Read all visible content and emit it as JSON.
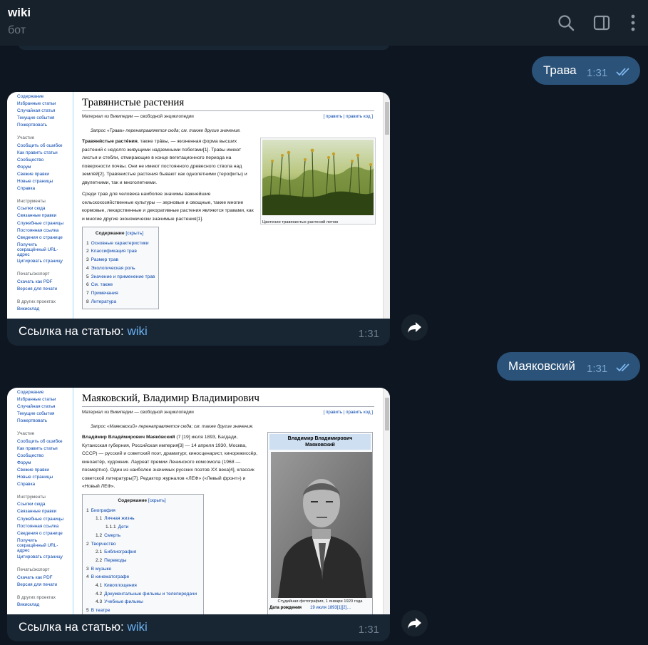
{
  "header": {
    "title": "wiki",
    "subtitle": "бот"
  },
  "messages_out": [
    {
      "text": "Трава",
      "time": "1:31"
    },
    {
      "text": "Маяковский",
      "time": "1:31"
    }
  ],
  "sidebar": {
    "nav": [
      "Содержание",
      "Избранные статьи",
      "Случайная статья",
      "Текущие события",
      "Пожертвовать"
    ],
    "group_participation": "Участие",
    "participation": [
      "Сообщить об ошибке",
      "Как править статьи",
      "Сообщество",
      "Форум",
      "Свежие правки",
      "Новые страницы",
      "Справка"
    ],
    "group_tools": "Инструменты",
    "tools": [
      "Ссылки сюда",
      "Связанные правки",
      "Служебные страницы",
      "Постоянная ссылка",
      "Сведения о странице",
      "Получить сокращённый URL-адрес",
      "Цитировать страницу"
    ],
    "group_print": "Печать/экспорт",
    "print": [
      "Скачать как PDF",
      "Версия для печати"
    ],
    "group_other": "В других проектах",
    "other": [
      "Викисклад"
    ]
  },
  "wiki1": {
    "title": "Травянистые растения",
    "source": "Материал из Википедии — свободной энциклопедии",
    "edit": "[ править | править код ]",
    "redirect": "Запрос «Трава» перенаправляется сюда; см. также другие значения.",
    "p1_bold": "Травяни́стые расте́ния",
    "p1_rest": ", также тра́вы, — жизненная форма высших растений с недолго живущими надземными побегами[1]. Травы имеют листья и стебли, отмирающие в конце вегетационного периода на поверхности почвы. Они не имеют постоянного древесного ствола над землёй[2]. Травянистые растения бывают как однолетними (терофиты) и двулетними, так и многолетними.",
    "p2": "Среди трав для человека наиболее значимы важнейшие сельскохозяйственные культуры — зерновые и овощные, также многие кормовые, лекарственные и декоративные растения являются травами, как и многие другие экономически значимые растения[1].",
    "image_caption": "Цветение травянистых растений летом",
    "toc_title": "Содержание",
    "toc_hide": "[скрыть]",
    "toc": [
      {
        "n": "1",
        "t": "Основные характеристики"
      },
      {
        "n": "2",
        "t": "Классификация трав"
      },
      {
        "n": "3",
        "t": "Размер трав"
      },
      {
        "n": "4",
        "t": "Экологическая роль"
      },
      {
        "n": "5",
        "t": "Значение и применение трав"
      },
      {
        "n": "6",
        "t": "См. также"
      },
      {
        "n": "7",
        "t": "Примечания"
      },
      {
        "n": "8",
        "t": "Литература"
      }
    ]
  },
  "wiki2": {
    "title": "Маяковский, Владимир Владимирович",
    "source": "Материал из Википедии — свободной энциклопедии",
    "edit": "[ править | править код ]",
    "redirect": "Запрос «Маяковский» перенаправляется сюда; см. также другие значения.",
    "p1_bold": "Влади́мир Влади́мирович Маяко́вский",
    "p1_rest": " (7 [19] июля 1893, Багдади, Кутаисская губерния, Российская империя[3] — 14 апреля 1930, Москва, СССР) — русский и советский поэт, драматург, киносценарист, кинорежиссёр, киноактёр, художник. Лауреат премии Ленинского комсомола (1968 — посмертно). Один из наиболее значимых русских поэтов XX века[4], классик советской литературы[7]. Редактор журналов «ЛЕФ» («Левый фронт») и «Новый ЛЕФ».",
    "infobox_name": "Владимир Владимирович Маяковский",
    "infobox_caption": "Студийная фотография, 1 январи 1920 года",
    "infobox_birth_label": "Дата рождения",
    "infobox_birth_value": "19 июля 1893[1][2]…",
    "toc_title": "Содержание",
    "toc_hide": "[скрыть]",
    "toc": [
      {
        "n": "1",
        "t": "Биография",
        "lvl": 0
      },
      {
        "n": "1.1",
        "t": "Личная жизнь",
        "lvl": 1
      },
      {
        "n": "1.1.1",
        "t": "Дети",
        "lvl": 2
      },
      {
        "n": "1.2",
        "t": "Смерть",
        "lvl": 1
      },
      {
        "n": "2",
        "t": "Творчество",
        "lvl": 0
      },
      {
        "n": "2.1",
        "t": "Библиография",
        "lvl": 1
      },
      {
        "n": "2.2",
        "t": "Переводы",
        "lvl": 1
      },
      {
        "n": "3",
        "t": "В музыке",
        "lvl": 0
      },
      {
        "n": "4",
        "t": "В кинематографе",
        "lvl": 0
      },
      {
        "n": "4.1",
        "t": "Кивоплощения",
        "lvl": 1
      },
      {
        "n": "4.2",
        "t": "Документальные фильмы и телепередачи",
        "lvl": 1
      },
      {
        "n": "4.3",
        "t": "Учебные фильмы",
        "lvl": 1
      },
      {
        "n": "5",
        "t": "В театре",
        "lvl": 0
      }
    ]
  },
  "captions": [
    {
      "prefix": "Ссылка на статью: ",
      "link": "wiki",
      "time": "1:31"
    },
    {
      "prefix": "Ссылка на статью: ",
      "link": "wiki",
      "time": "1:31"
    }
  ]
}
